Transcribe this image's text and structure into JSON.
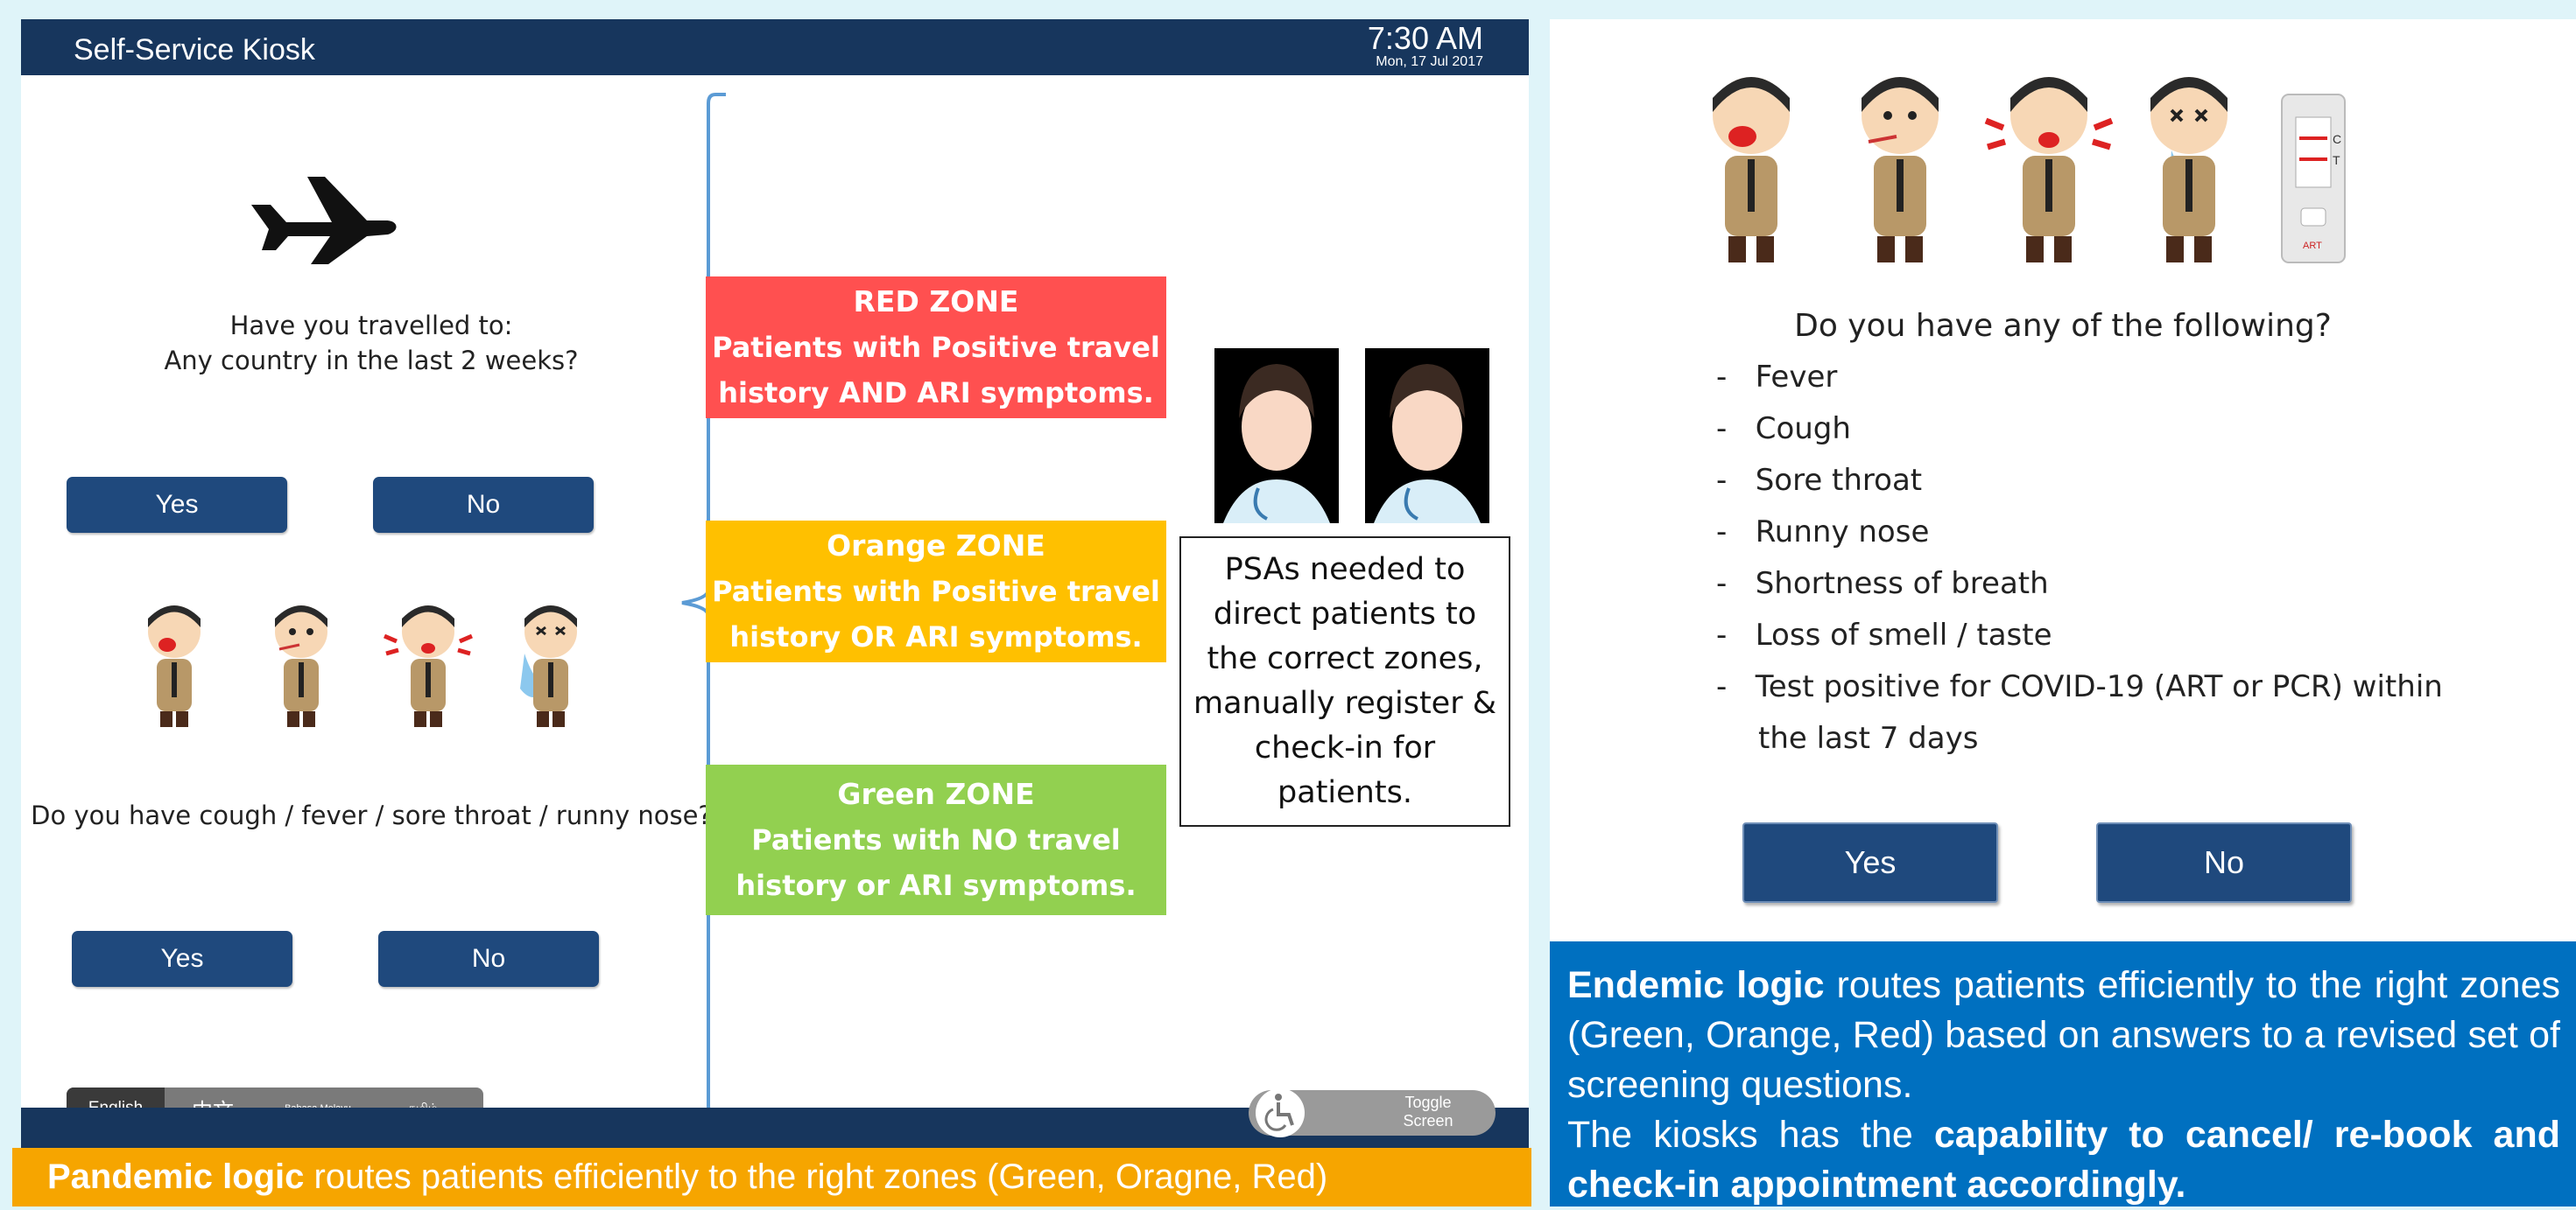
{
  "kiosk": {
    "title": "Self-Service Kiosk",
    "time": "7:30 AM",
    "date": "Mon, 17 Jul 2017",
    "travel_question_line1": "Have you travelled to:",
    "travel_question_line2": "Any country in the last 2 weeks?",
    "travel_yes": "Yes",
    "travel_no": "No",
    "symptom_question": "Do you have cough / fever / sore throat / runny nose?",
    "symptom_yes": "Yes",
    "symptom_no": "No",
    "languages": [
      "English",
      "中文",
      "Bahasa Melayu",
      "தமிழ்"
    ],
    "toggle_line1": "Toggle",
    "toggle_line2": "Screen"
  },
  "zones": [
    {
      "title": "RED ZONE",
      "line1": "Patients with Positive travel",
      "line2": "history AND ARI symptoms.",
      "color": "#ff5050"
    },
    {
      "title": "Orange ZONE",
      "line1": "Patients with Positive travel",
      "line2": "history OR ARI symptoms.",
      "color": "#ffc000"
    },
    {
      "title": "Green ZONE",
      "line1": "Patients with NO travel",
      "line2": "history or ARI symptoms.",
      "color": "#92d050"
    }
  ],
  "psa_note": [
    "PSAs needed to",
    "direct patients to",
    "the correct zones,",
    "manually register &",
    "check-in for",
    "patients."
  ],
  "pandemic_caption": {
    "bold": "Pandemic logic",
    "rest": " routes patients efficiently to the right zones (Green, Oragne, Red)"
  },
  "right": {
    "question": "Do you have any of the following?",
    "symptoms": [
      "Fever",
      "Cough",
      "Sore throat",
      "Runny nose",
      "Shortness of breath",
      "Loss of smell / taste",
      "Test positive for COVID-19 (ART or PCR) within"
    ],
    "symptom_continuation": "the last 7 days",
    "yes": "Yes",
    "no": "No",
    "test_kit_c": "C",
    "test_kit_t": "T",
    "test_kit_label": "ART"
  },
  "endemic_caption": {
    "bold1": "Endemic logic",
    "text1": " routes patients efficiently to the right zones (Green, Orange, Red) based on answers to a revised set of screening questions.",
    "text2": "The kiosks has the ",
    "bold2": "capability to cancel/ re-book and check-in appointment accordingly."
  },
  "colors": {
    "kiosk_navy": "#17365d",
    "button_blue": "#1f497d",
    "caption_orange": "#f6a500",
    "caption_blue": "#0070c0"
  }
}
